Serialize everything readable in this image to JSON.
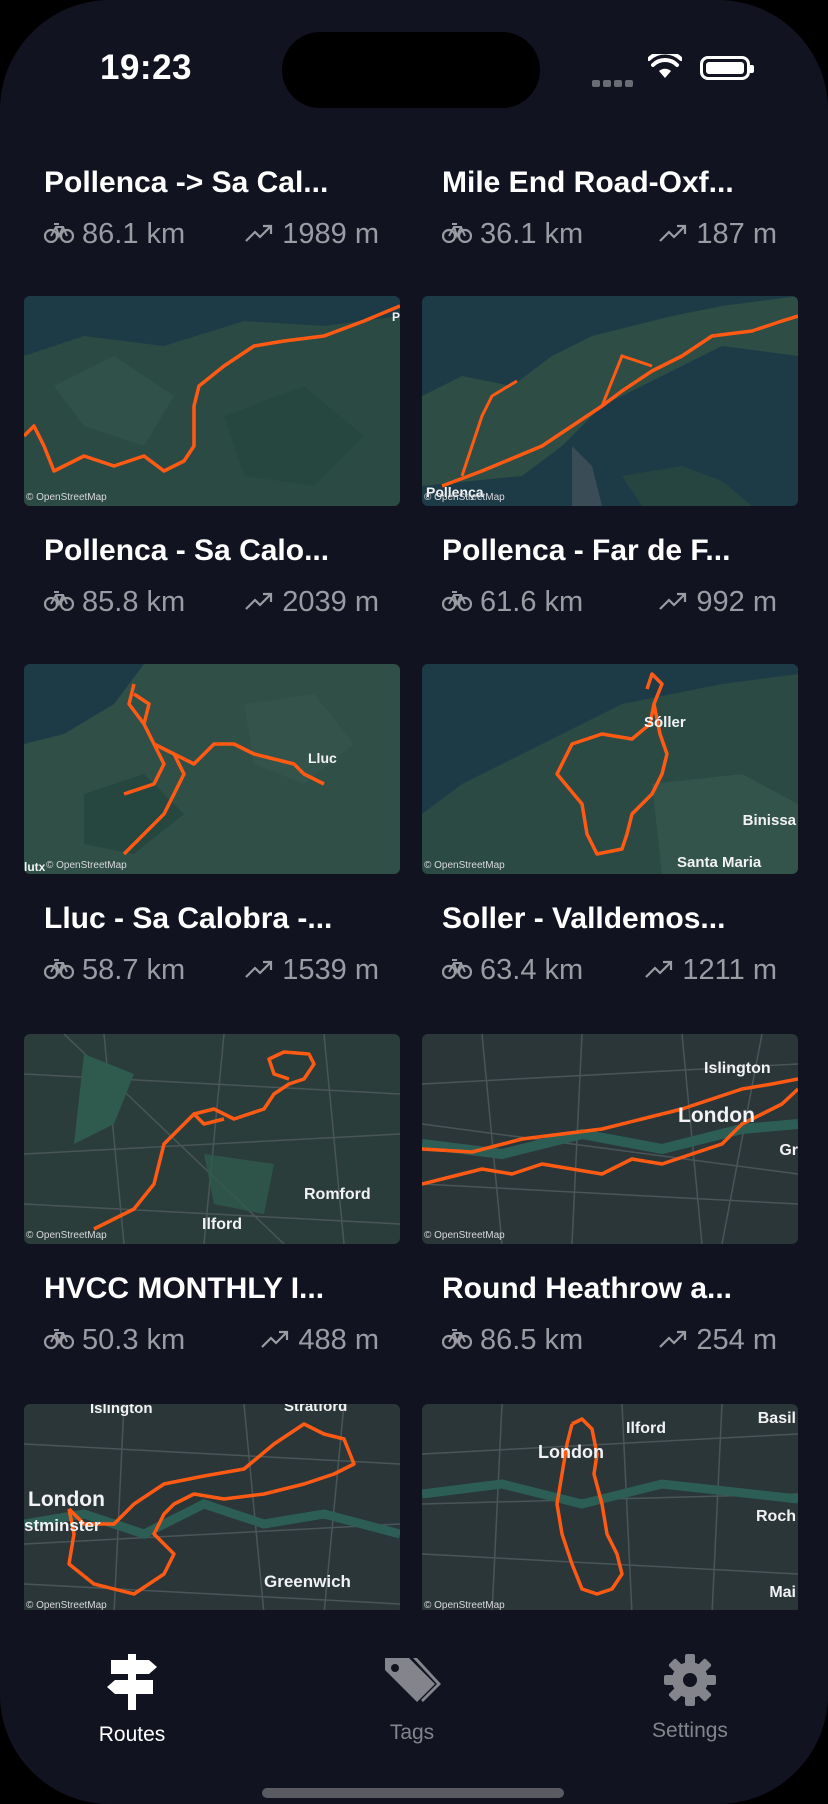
{
  "status_bar": {
    "time": "19:23"
  },
  "routes": [
    {
      "title": "Pollenca -> Sa Cal...",
      "distance": "86.1 km",
      "elevation": "1989 m"
    },
    {
      "title": "Mile End Road-Oxf...",
      "distance": "36.1 km",
      "elevation": "187 m"
    },
    {
      "title": "Pollenca - Sa Calo...",
      "distance": "85.8 km",
      "elevation": "2039 m",
      "map_labels": [
        "P"
      ]
    },
    {
      "title": "Pollenca - Far de F...",
      "distance": "61.6 km",
      "elevation": "992 m",
      "map_labels": [
        "Pollença"
      ]
    },
    {
      "title": "Lluc - Sa Calobra -...",
      "distance": "58.7 km",
      "elevation": "1539 m",
      "map_labels": [
        "Lluc",
        "lutx"
      ]
    },
    {
      "title": "Soller - Valldemos...",
      "distance": "63.4 km",
      "elevation": "1211 m",
      "map_labels": [
        "Sóller",
        "Binissa",
        "Santa Maria"
      ]
    },
    {
      "title": "HVCC MONTHLY I...",
      "distance": "50.3 km",
      "elevation": "488 m",
      "map_labels": [
        "Romford",
        "Ilford"
      ]
    },
    {
      "title": "Round Heathrow a...",
      "distance": "86.5 km",
      "elevation": "254 m",
      "map_labels": [
        "Islington",
        "London",
        "Gr"
      ]
    },
    {
      "title": "",
      "distance": "",
      "elevation": "",
      "map_labels": [
        "Islington",
        "Stratford",
        "London",
        "stminster",
        "Greenwich"
      ]
    },
    {
      "title": "",
      "distance": "",
      "elevation": "",
      "map_labels": [
        "Basil",
        "Ilford",
        "London",
        "Roch",
        "Mai"
      ]
    }
  ],
  "map_attribution": "© OpenStreetMap",
  "tabs": [
    {
      "label": "Routes",
      "icon": "signpost-icon",
      "active": true
    },
    {
      "label": "Tags",
      "icon": "tags-icon",
      "active": false
    },
    {
      "label": "Settings",
      "icon": "gear-icon",
      "active": false
    }
  ],
  "colors": {
    "background": "#121320",
    "route": "#ff5a14",
    "accent_text": "#ffffff",
    "muted_text": "#9b9ba4"
  }
}
